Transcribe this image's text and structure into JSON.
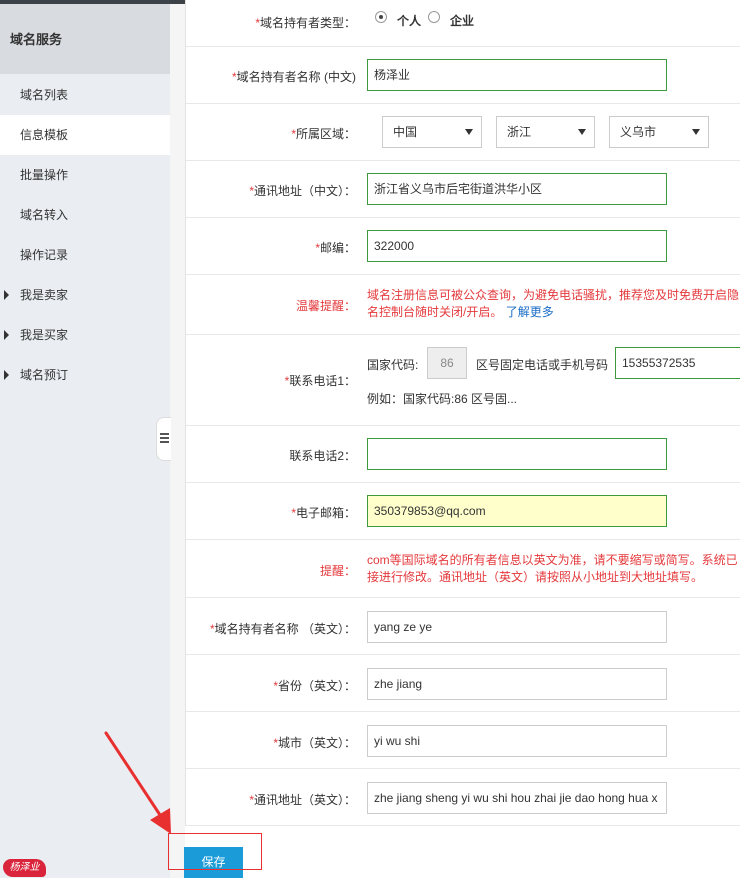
{
  "sidebar": {
    "title": "域名服务",
    "items": [
      {
        "label": "域名列表",
        "active": false
      },
      {
        "label": "信息模板",
        "active": true
      },
      {
        "label": "批量操作",
        "active": false
      },
      {
        "label": "域名转入",
        "active": false
      },
      {
        "label": "操作记录",
        "active": false
      },
      {
        "label": "我是卖家",
        "active": false
      },
      {
        "label": "我是买家",
        "active": false
      },
      {
        "label": "域名预订",
        "active": false
      }
    ]
  },
  "form": {
    "required_mark": "*",
    "holder_type": {
      "label": "域名持有者类型：",
      "options": [
        "个人",
        "企业"
      ],
      "selected": "个人"
    },
    "holder_name_cn": {
      "label": "域名持有者名称 (中文)",
      "value": "杨泽业"
    },
    "region": {
      "label": "所属区域：",
      "country": "中国",
      "province": "浙江",
      "city": "义乌市"
    },
    "address_cn": {
      "label": "通讯地址（中文）：",
      "value": "浙江省义乌市后宅街道洪华小区"
    },
    "postcode": {
      "label": "邮编：",
      "value": "322000"
    },
    "tip1": {
      "label": "温馨提醒：",
      "line1": "域名注册信息可被公众查询，为避免电话骚扰，推荐您及时免费开启隐",
      "line2": "名控制台随时关闭/开启。",
      "link": "了解更多"
    },
    "phone1": {
      "label": "联系电话1：",
      "country_code_label": "国家代码:",
      "country_code": "86",
      "number_label": "区号固定电话或手机号码",
      "number": "15355372535",
      "example": "例如：国家代码:86 区号固..."
    },
    "phone2": {
      "label": "联系电话2：",
      "value": ""
    },
    "email": {
      "label": "电子邮箱：",
      "value": "350379853@qq.com"
    },
    "tip2": {
      "label": "提醒：",
      "line1": "com等国际域名的所有者信息以英文为准，请不要缩写或简写。系统已",
      "line2": "接进行修改。通讯地址（英文）请按照从小地址到大地址填写。"
    },
    "holder_name_en": {
      "label": "域名持有者名称 （英文）：",
      "value": "yang ze ye"
    },
    "province_en": {
      "label": "省份（英文）：",
      "value": "zhe jiang"
    },
    "city_en": {
      "label": "城市（英文）：",
      "value": "yi wu shi"
    },
    "address_en": {
      "label": "通讯地址（英文）：",
      "value": "zhe jiang sheng yi wu shi hou zhai jie dao hong hua x"
    }
  },
  "save_label": "保存",
  "watermark": "杨泽业",
  "colors": {
    "accent": "#1b9cd8",
    "required": "#e4393c",
    "valid_border": "#3c9a3c",
    "annotation": "#e83030"
  }
}
